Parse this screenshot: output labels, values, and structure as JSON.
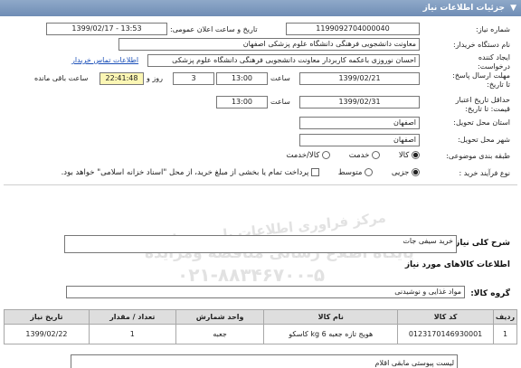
{
  "header": {
    "title": "جزئیات اطلاعات نیاز"
  },
  "fields": {
    "need_number_label": "شماره نیاز:",
    "need_number": "1199092704000040",
    "announce_label": "تاریخ و ساعت اعلان عمومی:",
    "announce_value": "1399/02/17 - 13:53",
    "buyer_label": "نام دستگاه خریدار:",
    "buyer_value": "معاونت دانشجویی فرهنگی دانشگاه علوم پزشکی اصفهان",
    "creator_label": "ایجاد کننده درخواست:",
    "creator_value": "احسان نوروزی باعکمه کاربردار معاونت دانشجویی فرهنگی دانشگاه علوم پزشکی",
    "contact_link": "اطلاعات تماس خریدار",
    "deadline_label": "مهلت ارسال پاسخ: تا تاریخ:",
    "deadline_date": "1399/02/21",
    "time_label": "ساعت",
    "deadline_time": "13:00",
    "days_value": "3",
    "days_label": "روز و",
    "remaining_time": "22:41:48",
    "remaining_label": "ساعت باقی مانده",
    "validity_label": "حداقل تاریخ اعتبار قیمت: تا تاریخ:",
    "validity_date": "1399/02/31",
    "validity_time": "13:00",
    "province_label": "استان محل تحویل:",
    "province_value": "اصفهان",
    "city_label": "شهر محل تحویل:",
    "city_value": "اصفهان",
    "category_label": "طبقه بندی موضوعی:",
    "category_goods": "کالا",
    "category_service": "خدمت",
    "category_both": "کالا/خدمت",
    "process_label": "نوع فرآیند خرید :",
    "process_partial": "جزیی",
    "process_medium": "متوسط",
    "payment_note": "پرداخت تمام یا بخشی از مبلغ خرید، از محل \"اسناد خزانه اسلامی\" خواهد بود."
  },
  "summary": {
    "label": "شرح کلی نیاز:",
    "value": "خرید سیفی جات"
  },
  "goods_section": {
    "title": "اطلاعات کالاهای مورد نیاز",
    "group_label": "گروه کالا:",
    "group_value": "مواد غذایی و نوشیدنی"
  },
  "table": {
    "headers": [
      "ردیف",
      "کد کالا",
      "نام کالا",
      "واحد شمارش",
      "تعداد / مقدار",
      "تاریخ نیاز"
    ],
    "rows": [
      [
        "1",
        "0123170146930001",
        "هویج تازه جعبه 6 kg کاسکو",
        "جعبه",
        "1",
        "1399/02/22"
      ]
    ]
  },
  "notes": {
    "value": "لیست پیوستی مابقی اقلام"
  },
  "watermark": {
    "line1": "مرکز فراوری اطلاعات پارس نماد داده",
    "line2": "پایگاه اطلاع رسانی مناقصه ومزایده",
    "line3": "۰۲۱-۸۸۳۴۶۷۰۰-۵"
  }
}
